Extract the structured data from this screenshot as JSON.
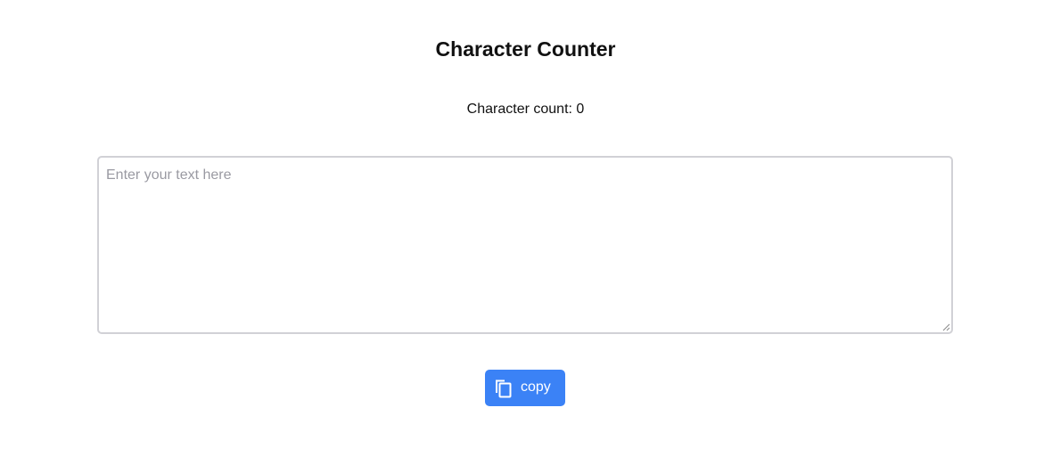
{
  "page": {
    "title": "Character Counter"
  },
  "counter": {
    "label": "Character count: ",
    "value": "0"
  },
  "editor": {
    "value": "",
    "placeholder": "Enter your text here"
  },
  "actions": {
    "copy_label": "copy",
    "copy_icon": "copy-icon"
  },
  "colors": {
    "button_background": "#3b82f6",
    "button_text": "#ffffff",
    "textarea_border": "#d1d1d6",
    "placeholder": "#9a9aa2"
  }
}
